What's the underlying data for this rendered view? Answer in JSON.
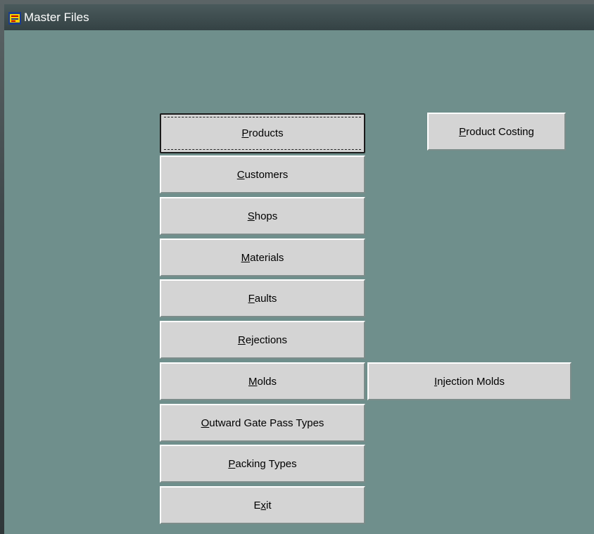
{
  "window": {
    "title": "Master Files",
    "title_icon": "oracle-forms-icon"
  },
  "buttons": {
    "products": "Products",
    "customers": "Customers",
    "shops": "Shops",
    "materials": "Materials",
    "faults": "Faults",
    "rejections": "Rejections",
    "molds": "Molds",
    "outward_gate_pass_types": "Outward Gate Pass Types",
    "packing_types": "Packing Types",
    "exit": "Exit",
    "product_costing": "Product Costing",
    "injection_molds": "Injection Molds"
  },
  "colors": {
    "canvas": "#6f8f8c",
    "button_face": "#d4d4d4",
    "titlebar": "#3b4a4c"
  }
}
